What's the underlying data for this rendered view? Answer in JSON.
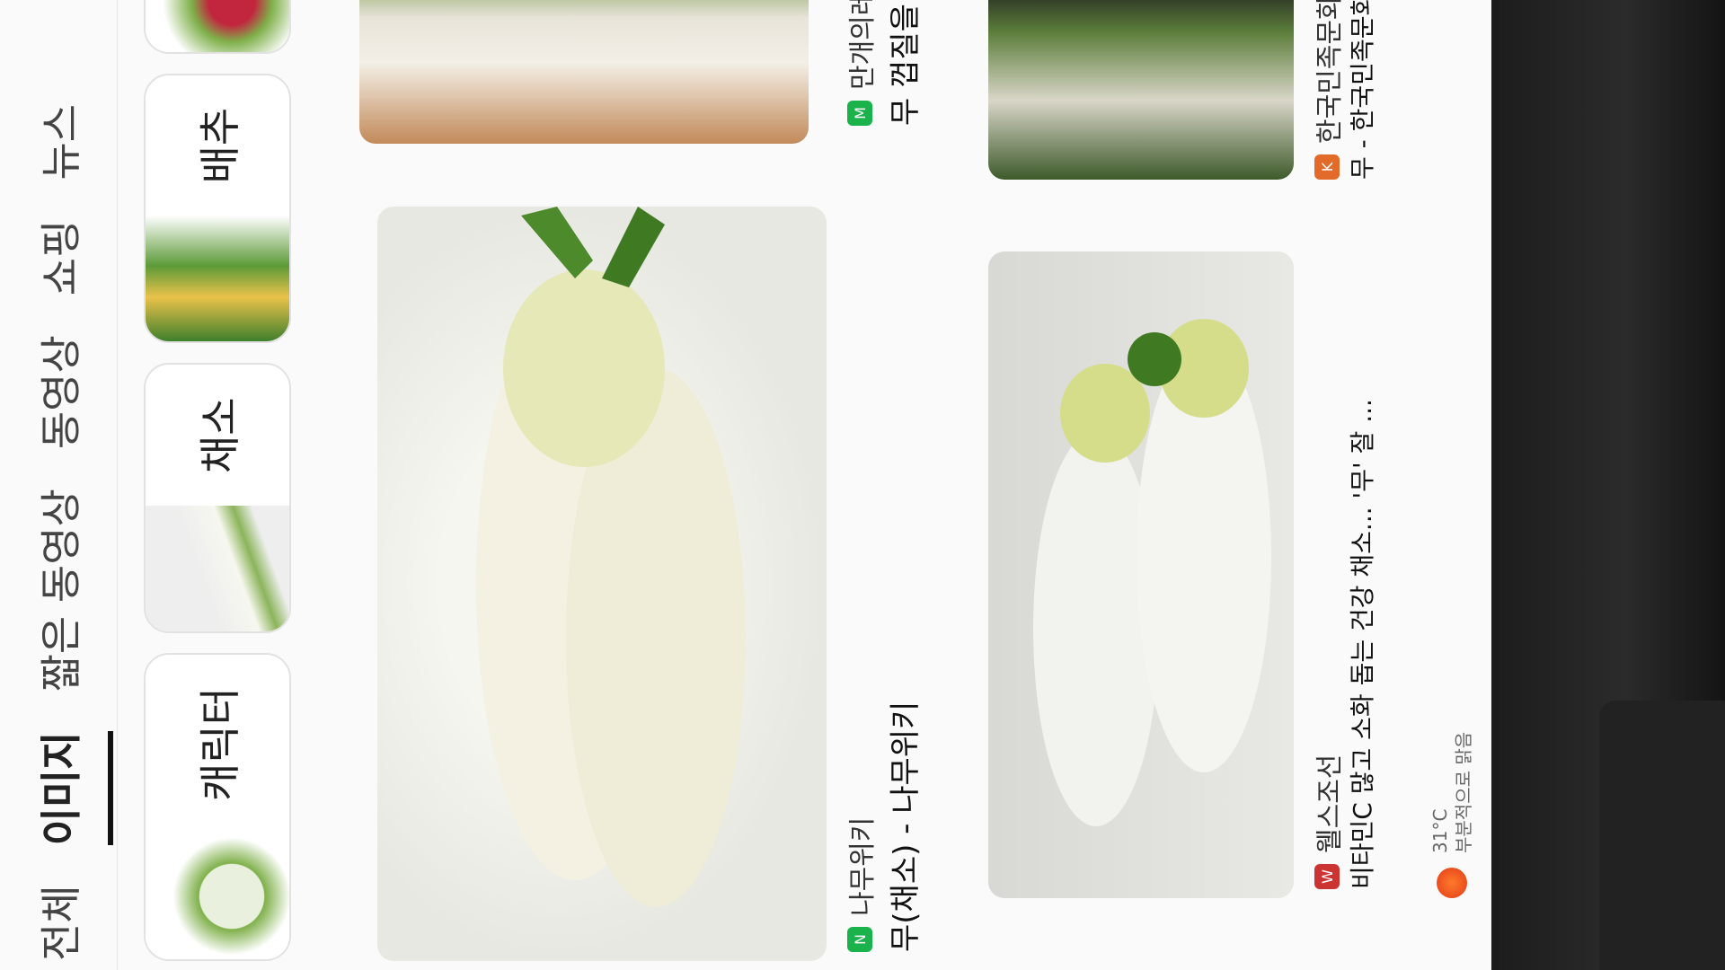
{
  "tabs": [
    "전체",
    "이미지",
    "짧은 동영상",
    "동영상",
    "쇼핑",
    "뉴스"
  ],
  "active_tab": "이미지",
  "chips": [
    "캐릭터",
    "채소",
    "배추"
  ],
  "results": [
    {
      "source": "나무위키",
      "caption": "무(채소) - 나무위키"
    },
    {
      "source": "만개의레시피",
      "caption": "무 껍질을 절대"
    },
    {
      "source": "웰스조선",
      "caption": "비타민C 많고 소화 돕는 건강 채소... '무' 잘 ..."
    },
    {
      "source": "한국민족문화대백",
      "caption": "무 - 한국민족문화"
    }
  ],
  "weather": {
    "temp": "31°C",
    "desc": "부분적으로 맑음"
  }
}
